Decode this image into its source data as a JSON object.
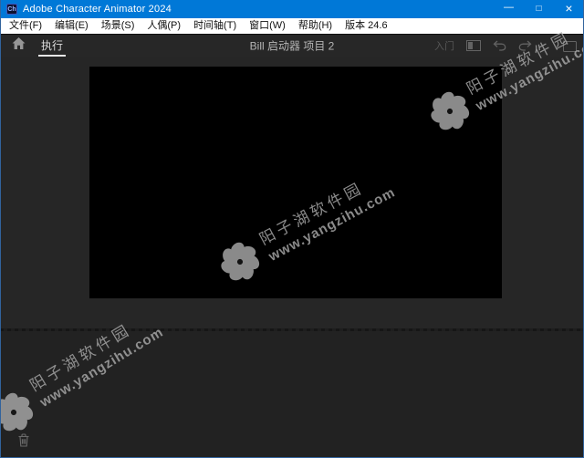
{
  "window": {
    "title": "Adobe Character Animator 2024",
    "app_icon": "Ch",
    "controls": {
      "minimize": "—",
      "maximize": "□",
      "close": "×"
    }
  },
  "menu": {
    "items": [
      "文件(F)",
      "编辑(E)",
      "场景(S)",
      "人偶(P)",
      "时间轴(T)",
      "窗口(W)",
      "帮助(H)",
      "版本 24.6"
    ]
  },
  "toolbar": {
    "active_tab": "执行",
    "project_title": "Bill 启动器 项目 2",
    "get_started_label": "入门",
    "icons": [
      "home-icon",
      "panel-toggle-icon",
      "undo-icon",
      "redo-icon",
      "snapshot-icon"
    ]
  },
  "watermark": {
    "line1": "阳子湖软件园",
    "line2": "www.yangzihu.com",
    "logo": "pinwheel-logo"
  },
  "colors": {
    "titlebar": "#0078d7",
    "menubar": "#ffffff",
    "toolbar": "#272727",
    "scene_panel": "#262626",
    "timeline_panel": "#222222",
    "canvas": "#000000",
    "window_border": "#31639c",
    "watermark": "#a9a9a9",
    "tab_underline": "#e8e8e8"
  }
}
